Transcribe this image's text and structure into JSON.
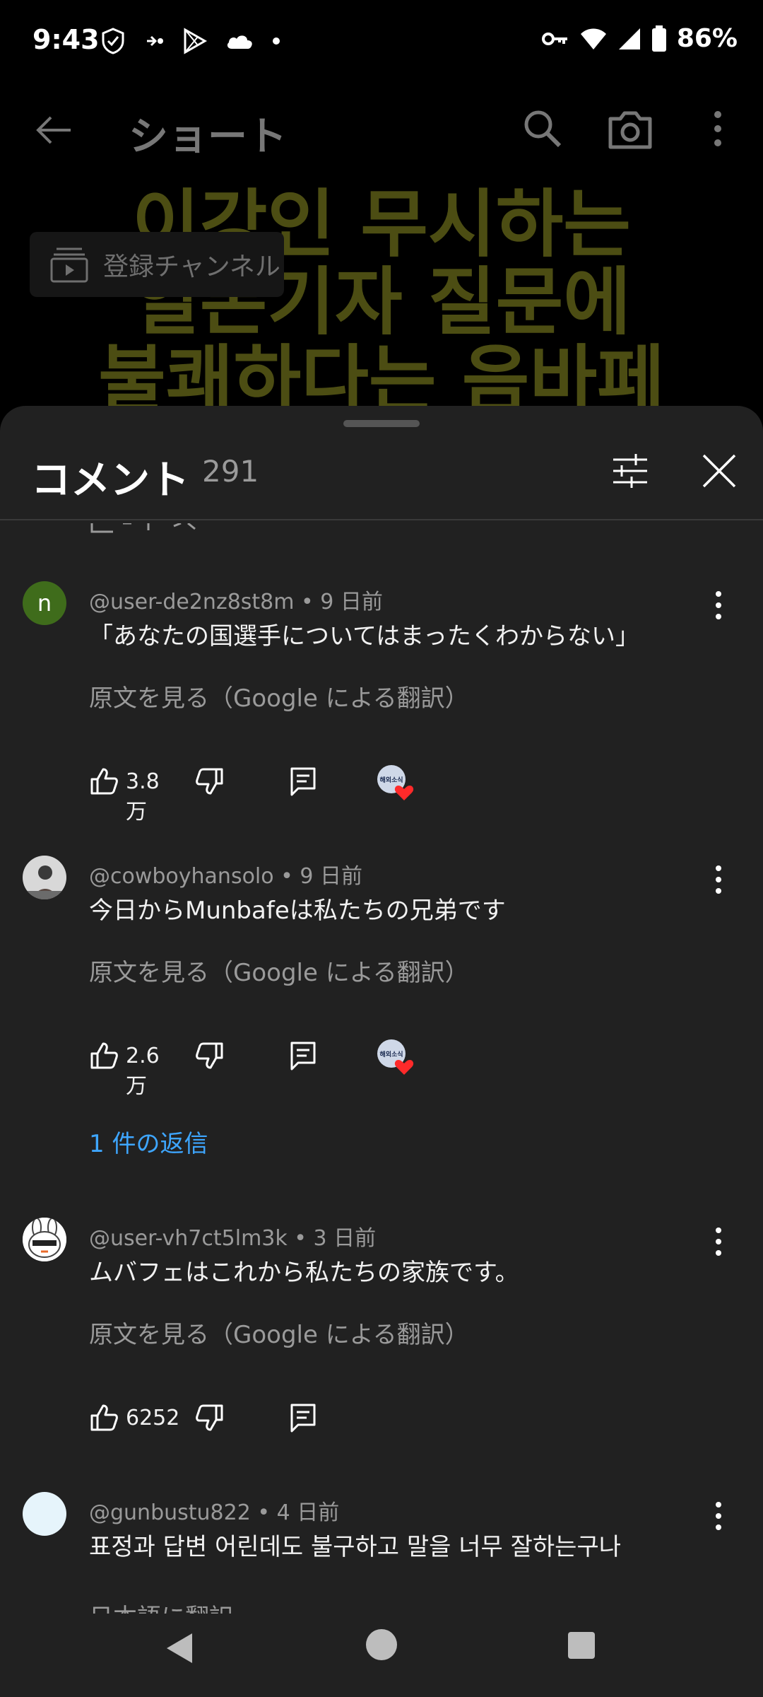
{
  "status_bar": {
    "time": "9:43",
    "battery": "86%"
  },
  "header": {
    "title": "ショート"
  },
  "video": {
    "overlay_lines": [
      "이강인 무시하는",
      "일본기자 질문에",
      "불쾌하다는 음바페"
    ],
    "chip_label": "登録チャンネル"
  },
  "sheet": {
    "title": "コメント",
    "count": "291",
    "comments": [
      {
        "author": "@user-de2nz8st8m",
        "age": "9 日前",
        "text": "「あなたの国選手についてはまったくわからない」",
        "translate_label": "原文を見る（Google による翻訳）",
        "likes": "3.8万",
        "avatar_letter": "n",
        "avatar_color": "#3f6c1b",
        "creator_heart": true
      },
      {
        "author": "@cowboyhansolo",
        "age": "9 日前",
        "text": "今日からMunbafeは私たちの兄弟です",
        "translate_label": "原文を見る（Google による翻訳）",
        "likes": "2.6万",
        "creator_heart": true,
        "replies_label": "1 件の返信"
      },
      {
        "author": "@user-vh7ct5lm3k",
        "age": "3 日前",
        "text": "ムバフェはこれから私たちの家族です。",
        "translate_label": "原文を見る（Google による翻訳）",
        "likes": "6252",
        "creator_heart": false
      },
      {
        "author": "@gunbustu822",
        "age": "4 日前",
        "text": "표정과 답변 어린데도 불구하고 말을 너무 잘하는구나",
        "partial_label": "日本語に翻訳"
      }
    ],
    "heart_badge_text": "해외소식"
  },
  "colors": {
    "sheet_bg": "#212121",
    "link": "#3ea6ff",
    "heart": "#ff2a2a"
  },
  "icons": [
    "back-arrow-icon",
    "search-icon",
    "camera-icon",
    "more-vert-icon",
    "filter-icon",
    "close-icon",
    "thumb-up-icon",
    "thumb-down-icon",
    "reply-icon"
  ]
}
